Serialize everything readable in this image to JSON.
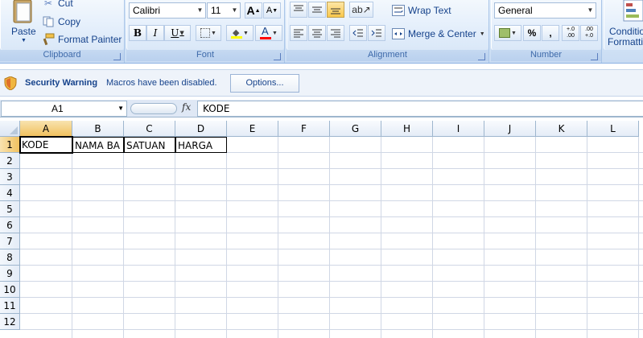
{
  "clipboard": {
    "paste_label": "Paste",
    "cut_label": "Cut",
    "copy_label": "Copy",
    "format_painter_label": "Format Painter",
    "group_label": "Clipboard"
  },
  "font": {
    "family": "Calibri",
    "size": "11",
    "group_label": "Font",
    "bold": "B",
    "italic": "I",
    "underline": "U",
    "grow": "A",
    "shrink": "A",
    "font_color": "A",
    "font_color_bar": "#ff0000",
    "fill_color_bar": "#ffff00"
  },
  "alignment": {
    "wrap_text_label": "Wrap Text",
    "merge_center_label": "Merge & Center",
    "group_label": "Alignment"
  },
  "number": {
    "format": "General",
    "percent": "%",
    "comma": ",",
    "inc_decimal": "+.0 .00",
    "dec_decimal": ".00 +.0",
    "group_label": "Number"
  },
  "styles": {
    "conditional_label": "Conditio",
    "formatting_label": "Formatti"
  },
  "security": {
    "title": "Security Warning",
    "message": "Macros have been disabled.",
    "options_label": "Options..."
  },
  "formula_bar": {
    "name_box": "A1",
    "fx": "fx",
    "content": "KODE"
  },
  "grid": {
    "columns": [
      "A",
      "B",
      "C",
      "D",
      "E",
      "F",
      "G",
      "H",
      "I",
      "J",
      "K",
      "L"
    ],
    "rows": [
      "1",
      "2",
      "3",
      "4",
      "5",
      "6",
      "7",
      "8",
      "9",
      "10",
      "11",
      "12"
    ],
    "cells": {
      "A1": "KODE",
      "B1": "NAMA BA",
      "C1": "SATUAN",
      "D1": "HARGA"
    },
    "active_cell": "A1"
  },
  "colors": {
    "accent": "#15428b",
    "ribbon": "#d5e5f7",
    "selected_header": "#f1c15f"
  }
}
